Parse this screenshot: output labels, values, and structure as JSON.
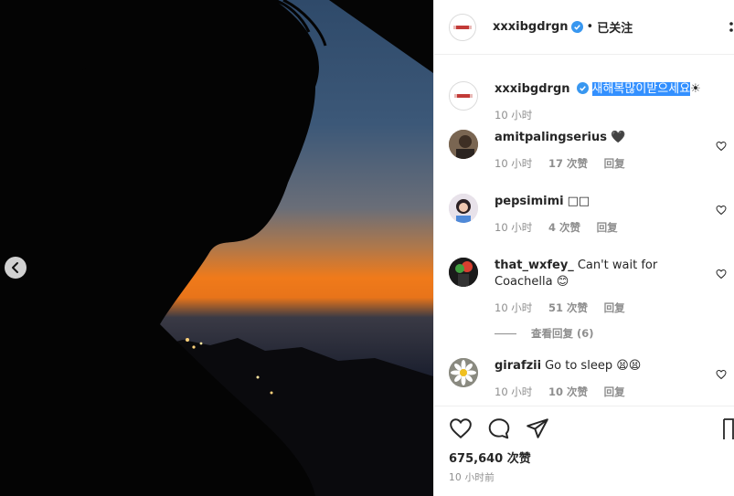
{
  "post": {
    "username": "xxxibgdrgn",
    "follow_status": "已关注",
    "caption_highlighted": "새해복많이받으세요",
    "caption_suffix": "☀",
    "caption_time": "10 小时"
  },
  "comments": [
    {
      "username": "amitpalingserius",
      "text": "🖤",
      "time": "10 小时",
      "likes": "17 次赞",
      "reply": "回复"
    },
    {
      "username": "pepsimimi",
      "text": "□□",
      "time": "10 小时",
      "likes": "4 次赞",
      "reply": "回复"
    },
    {
      "username": "that_wxfey_",
      "text": "Can't wait for Coachella 😊",
      "time": "10 小时",
      "likes": "51 次赞",
      "reply": "回复",
      "view_replies": "查看回复 (6)"
    },
    {
      "username": "girafzii",
      "text": "Go to sleep 😫😫",
      "time": "10 小时",
      "likes": "10 次赞",
      "reply": "回复"
    }
  ],
  "footer": {
    "likes": "675,640 次赞",
    "time": "10 小时前"
  },
  "icons": {
    "heart": "heart-icon",
    "comment": "comment-icon",
    "share": "share-icon",
    "bookmark": "bookmark-icon",
    "verified": "verified-badge-icon",
    "prev": "chevron-left-icon",
    "more": "more-icon"
  },
  "colors": {
    "highlight": "#3390ff",
    "verified": "#3897f0",
    "meta": "#8e8e8e"
  }
}
